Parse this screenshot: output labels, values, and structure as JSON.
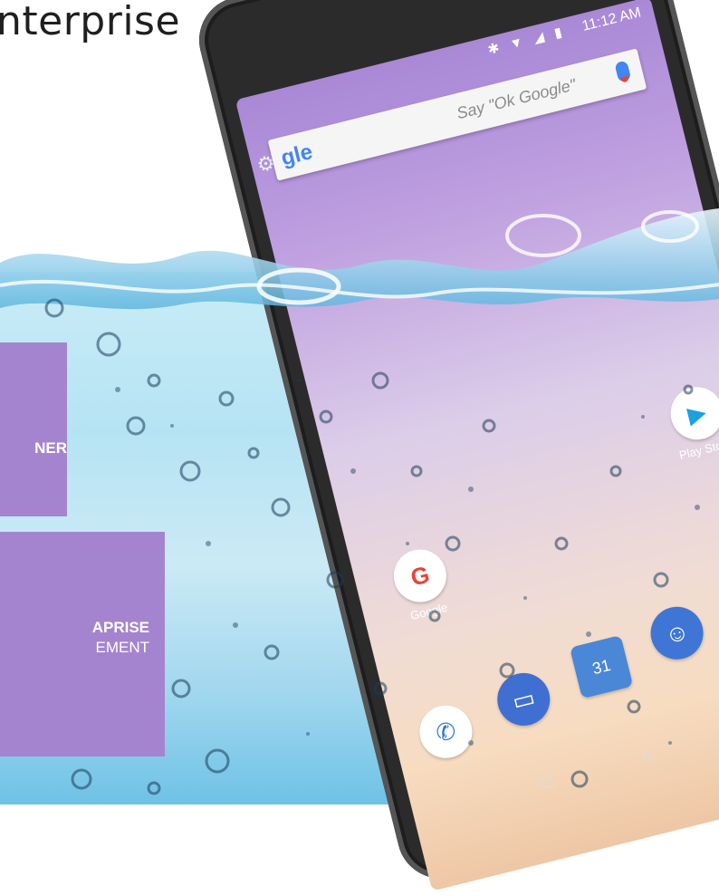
{
  "heading": {
    "text": "nterprise"
  },
  "phone": {
    "status": {
      "time": "11:12 AM",
      "icons": "✱ ▼ ◢ ▮"
    },
    "search": {
      "logo": "gle",
      "hint": "Say \"Ok Google\""
    },
    "apps": [
      {
        "label": "Play Store",
        "icon": "play-store-icon",
        "color": "#ffffff"
      },
      {
        "label": "Google",
        "icon": "google-icon",
        "color": "#ffffff"
      },
      {
        "label": "",
        "icon": "camera-icon",
        "color": "#5e6ad2"
      },
      {
        "label": "",
        "icon": "contacts-icon",
        "color": "#3f76d6"
      },
      {
        "label": "",
        "icon": "calendar-icon",
        "color": "#4a87d6",
        "badge": "31"
      },
      {
        "label": "",
        "icon": "messages-icon",
        "color": "#3f6fd1"
      },
      {
        "label": "",
        "icon": "phone-icon",
        "color": "#ffffff"
      }
    ]
  },
  "cards": [
    {
      "line1": "NER",
      "line2": ""
    },
    {
      "line1": "APRISE",
      "line2": "EMENT"
    }
  ],
  "colors": {
    "card": "#a584cf",
    "water": "#b6e3f3",
    "screen_top": "#a988d6"
  }
}
